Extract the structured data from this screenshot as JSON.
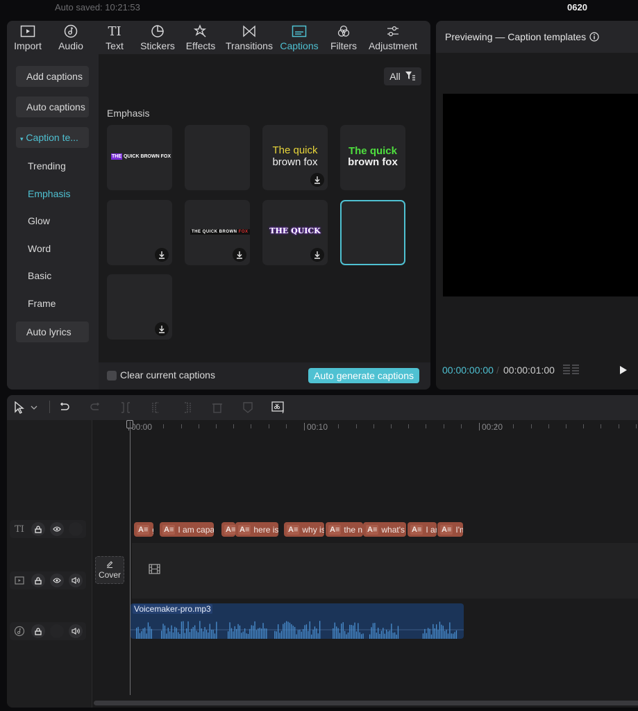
{
  "topbar": {
    "autosaved": "Auto saved: 10:21:53",
    "project_name": "0620"
  },
  "toolbar": {
    "active": "Captions",
    "accent_color": "#4fc1d2",
    "items": [
      {
        "label": "Import",
        "icon": "import-icon"
      },
      {
        "label": "Audio",
        "icon": "audio-icon"
      },
      {
        "label": "Text",
        "icon": "text-icon"
      },
      {
        "label": "Stickers",
        "icon": "stickers-icon"
      },
      {
        "label": "Effects",
        "icon": "effects-icon"
      },
      {
        "label": "Transitions",
        "icon": "transitions-icon"
      },
      {
        "label": "Captions",
        "icon": "captions-icon"
      },
      {
        "label": "Filters",
        "icon": "filters-icon"
      },
      {
        "label": "Adjustment",
        "icon": "adjustment-icon"
      }
    ]
  },
  "side_nav": {
    "add_captions": "Add captions",
    "auto_captions": "Auto captions",
    "caption_templates": "Caption te...",
    "sub_items": [
      "Trending",
      "Emphasis",
      "Glow",
      "Word",
      "Basic",
      "Frame"
    ],
    "active_sub": "Emphasis",
    "auto_lyrics": "Auto lyrics"
  },
  "content": {
    "filter_label": "All",
    "section_title": "Emphasis",
    "templates": [
      {
        "preview": "THE QUICK BROWN FOX",
        "highlight": "THE",
        "download": false
      },
      {
        "preview": "",
        "download": false
      },
      {
        "preview_line1": "The quick",
        "preview_line2": "brown fox",
        "color": "#e8d53a",
        "download": true
      },
      {
        "preview_line1": "The quick",
        "preview_line2": "brown fox",
        "color": "#4ede3e",
        "download": false
      },
      {
        "preview": "",
        "download": true
      },
      {
        "preview": "THE QUICK BROWN",
        "highlight": "FOX",
        "download": true
      },
      {
        "preview": "THE QUICK",
        "download": true
      },
      {
        "preview": "",
        "download": false,
        "selected": true
      },
      {
        "preview": "",
        "download": true
      }
    ],
    "clear_captions_label": "Clear current captions",
    "clear_captions_checked": false,
    "auto_generate_label": "Auto generate captions"
  },
  "preview": {
    "title": "Previewing — Caption templates",
    "current_time": "00:00:00:00",
    "separator": "/",
    "total_time": "00:00:01:00"
  },
  "timeline": {
    "ruler_labels": [
      "00:00",
      "00:10",
      "00:20"
    ],
    "caption_clips": [
      "g",
      "I am capa",
      "",
      "here is",
      "why is",
      "the n",
      "what's",
      "I ar",
      "I'm"
    ],
    "cover_label": "Cover",
    "audio_clip_name": "Voicemaker-pro.mp3"
  }
}
